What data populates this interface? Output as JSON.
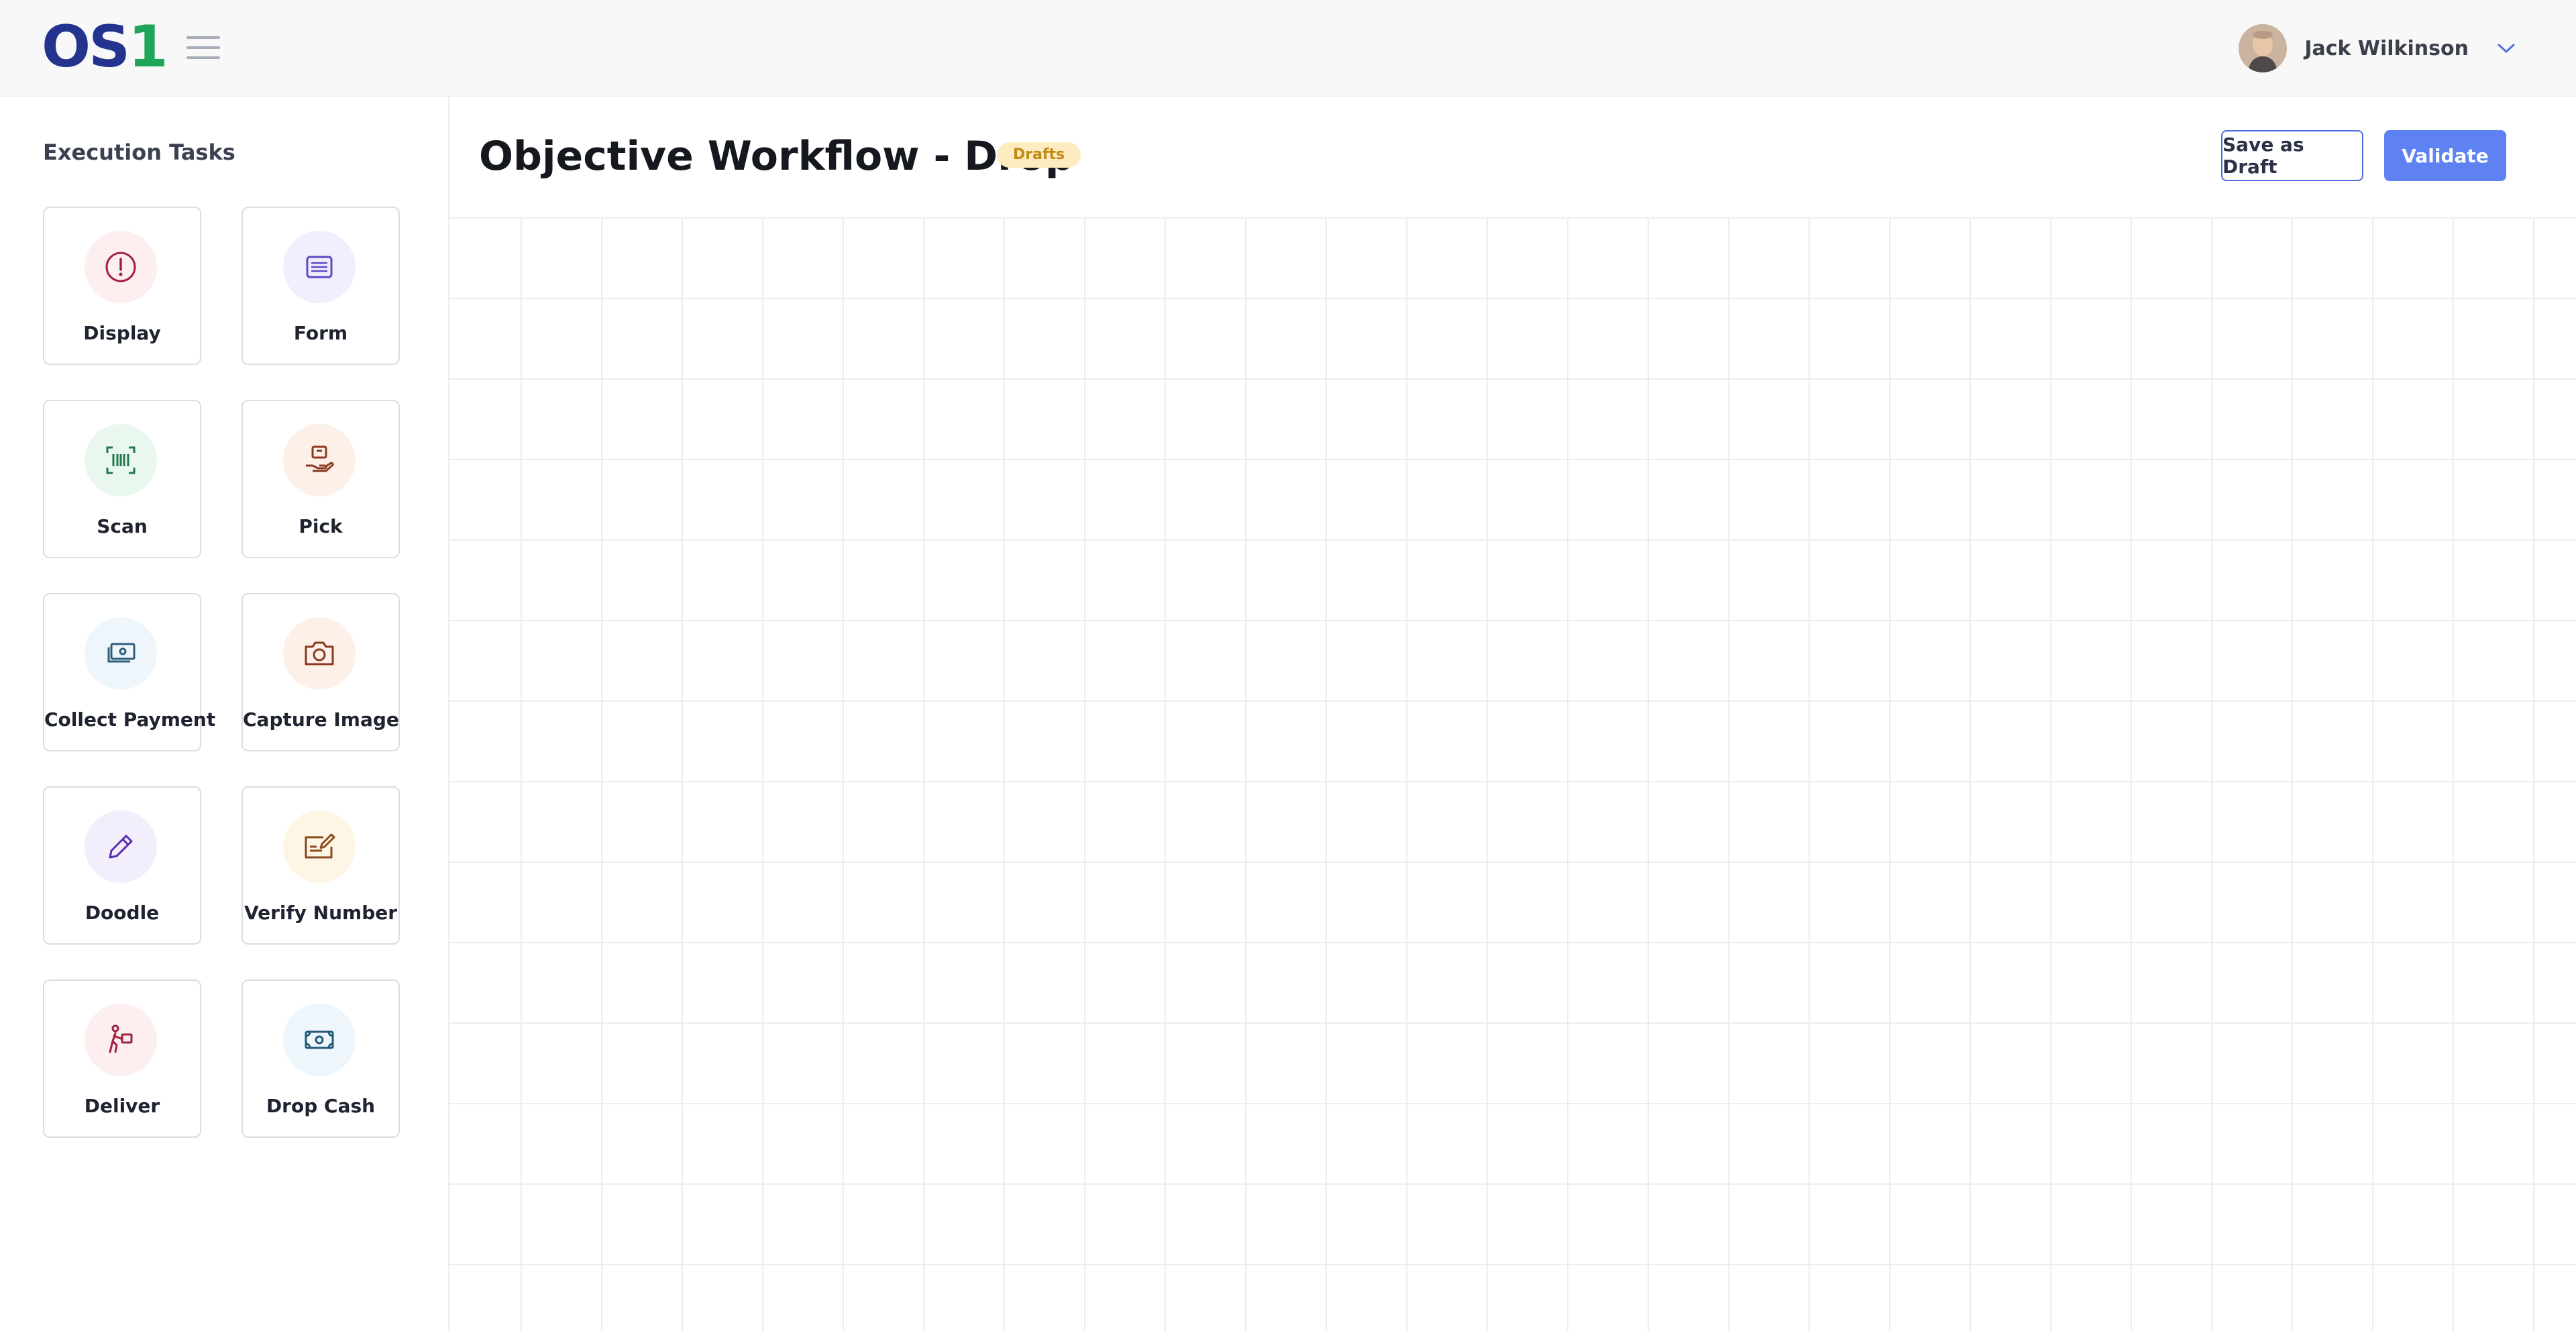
{
  "app": {
    "logo_text_1": "OS",
    "logo_text_2": "1",
    "brand_colors": {
      "primary": "#24348e",
      "accent": "#1fa55a"
    }
  },
  "header": {
    "user_name": "Jack Wilkinson",
    "menu_icon": "hamburger-icon",
    "dropdown_icon": "chevron-down-icon"
  },
  "sidebar": {
    "title": "Execution Tasks",
    "items": [
      {
        "label": "Display",
        "icon": "alert-circle-icon",
        "color": "#a1213f",
        "bg": "#fdeef0"
      },
      {
        "label": "Form",
        "icon": "form-list-icon",
        "color": "#5b4bc8",
        "bg": "#f1effd"
      },
      {
        "label": "Scan",
        "icon": "barcode-scan-icon",
        "color": "#1f7a4c",
        "bg": "#e9f7ef"
      },
      {
        "label": "Pick",
        "icon": "hand-package-icon",
        "color": "#8a3a1f",
        "bg": "#fdf0e8"
      },
      {
        "label": "Collect Payment",
        "icon": "cash-stack-icon",
        "color": "#2e5f7a",
        "bg": "#eef6fb"
      },
      {
        "label": "Capture Image",
        "icon": "camera-icon",
        "color": "#8a3a1f",
        "bg": "#fdf0e8"
      },
      {
        "label": "Doodle",
        "icon": "pencil-icon",
        "color": "#5b2bb0",
        "bg": "#f2eefc"
      },
      {
        "label": "Verify Number",
        "icon": "signature-icon",
        "color": "#8a4a1f",
        "bg": "#fdf6e4"
      },
      {
        "label": "Deliver",
        "icon": "person-delivery-icon",
        "color": "#a1213f",
        "bg": "#fdeef0"
      },
      {
        "label": "Drop Cash",
        "icon": "banknote-icon",
        "color": "#1e5a7a",
        "bg": "#eef6fb"
      }
    ]
  },
  "main": {
    "title": "Objective Workflow - Drop",
    "badge": "Drafts",
    "save_draft_label": "Save as Draft",
    "validate_label": "Validate"
  }
}
